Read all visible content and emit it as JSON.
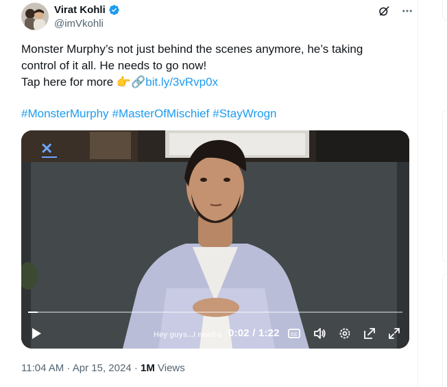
{
  "author": {
    "name": "Virat Kohli",
    "handle": "@imVkohli",
    "verified": true
  },
  "tweet": {
    "line1": "Monster Murphy’s not just behind the scenes anymore, he’s taking",
    "line2": "control of it all. He needs to go now!",
    "line3_prefix": "Tap here for more ",
    "pointing_emoji": "👉",
    "link_emoji": "🔗",
    "link_text": "bit.ly/3vRvp0x",
    "hashtags": [
      "#MonsterMurphy",
      "#MasterOfMischief",
      "#StayWrogn"
    ]
  },
  "video": {
    "caption": "Hey guys...I need a",
    "current_time": "0:02",
    "duration": "1:22",
    "time_display": "0:02 / 1:22",
    "progress_fraction": 0.025
  },
  "meta": {
    "timestamp": "11:04 AM · Apr 15, 2024 · ",
    "views_count": "1M",
    "views_label": " Views"
  },
  "colors": {
    "link": "#1d9bf0",
    "verified": "#1d9bf0",
    "text": "#0f1419",
    "secondary": "#536471"
  },
  "icons": [
    "verified-badge-icon",
    "grok-icon",
    "more-icon",
    "play-icon",
    "captions-icon",
    "volume-icon",
    "settings-icon",
    "pop-out-icon",
    "fullscreen-icon"
  ]
}
